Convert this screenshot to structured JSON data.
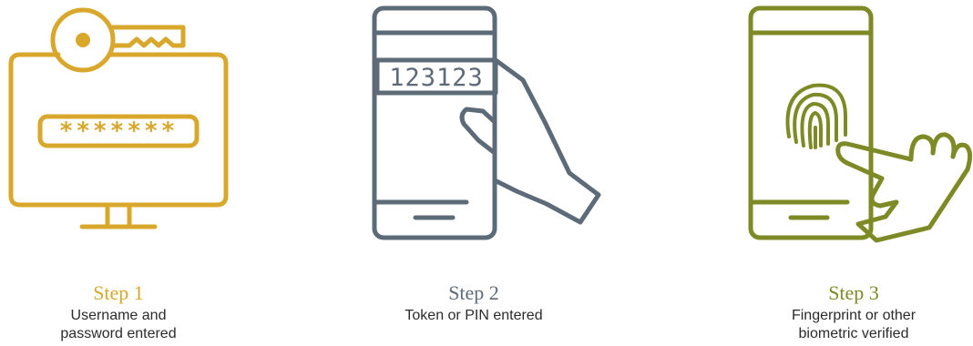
{
  "colors": {
    "step1": "#d9a72c",
    "step2": "#5d6b78",
    "step3": "#7e8a25"
  },
  "steps": [
    {
      "title": "Step 1",
      "description": "Username and\npassword entered",
      "icon": "monitor-key-password-icon",
      "password_mask": "*******"
    },
    {
      "title": "Step 2",
      "description": "Token or PIN entered",
      "icon": "phone-token-hand-icon",
      "token_display": "123123"
    },
    {
      "title": "Step 3",
      "description": "Fingerprint or other\nbiometric verified",
      "icon": "phone-fingerprint-touch-icon"
    }
  ]
}
